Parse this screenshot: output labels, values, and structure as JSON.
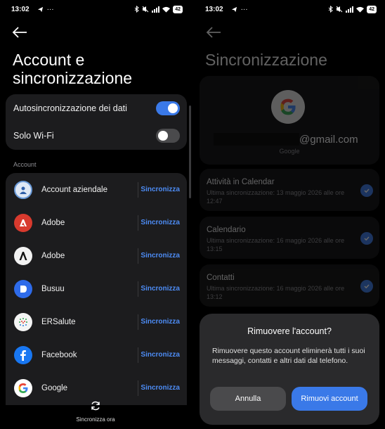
{
  "left": {
    "status": {
      "time": "13:02",
      "battery": "42"
    },
    "title_line1": "Account e",
    "title_line2": "sincronizzazione",
    "toggles": [
      {
        "label": "Autosincronizzazione dei dati",
        "on": true
      },
      {
        "label": "Solo Wi-Fi",
        "on": false
      }
    ],
    "section_label": "Account",
    "accounts": [
      {
        "name": "Account aziendale",
        "action": "Sincronizza",
        "icon": "work-profile-icon"
      },
      {
        "name": "Adobe",
        "action": "Sincronizza",
        "icon": "adobe-icon"
      },
      {
        "name": "Adobe",
        "action": "Sincronizza",
        "icon": "adobe-fill-icon"
      },
      {
        "name": "Busuu",
        "action": "Sincronizza",
        "icon": "busuu-icon"
      },
      {
        "name": "ERSalute",
        "action": "Sincronizza",
        "icon": "ersalute-icon"
      },
      {
        "name": "Facebook",
        "action": "Sincronizza",
        "icon": "facebook-icon"
      },
      {
        "name": "Google",
        "action": "Sincronizza",
        "icon": "google-icon"
      }
    ],
    "bottom_action": "Sincronizza ora"
  },
  "right": {
    "status": {
      "time": "13:02",
      "battery": "42"
    },
    "title": "Sincronizzazione",
    "email_domain": "@gmail.com",
    "account_type": "Google",
    "sync_items": [
      {
        "title": "Attività in Calendar",
        "sub": "Ultima sincronizzazione: 13 maggio 2026 alle ore 12:47"
      },
      {
        "title": "Calendario",
        "sub": "Ultima sincronizzazione: 16 maggio 2026 alle ore 13:15"
      },
      {
        "title": "Contatti",
        "sub": "Ultima sincronizzazione: 16 maggio 2026 alle ore 13:12"
      }
    ],
    "dialog": {
      "title": "Rimuovere l'account?",
      "message": "Rimuovere questo account eliminerà tutti i suoi messaggi, contatti e altri dati dal telefono.",
      "cancel": "Annulla",
      "confirm": "Rimuovi account"
    }
  },
  "colors": {
    "accent": "#3a79e8",
    "link": "#4d8cf5",
    "card": "#1c1c1e",
    "dialog": "#2a2a2c"
  }
}
